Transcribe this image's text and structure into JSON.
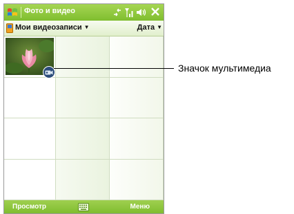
{
  "window": {
    "title": "Фото и видео"
  },
  "toolbar": {
    "folder_label": "Мои видеозаписи",
    "sort_label": "Дата"
  },
  "softkeys": {
    "left": "Просмотр",
    "right": "Меню"
  },
  "callout": {
    "text": "Значок мультимедиа"
  },
  "icons": {
    "start": "windows-flag-icon",
    "connectivity": "connectivity-icon",
    "signal": "signal-icon",
    "volume": "volume-icon",
    "close": "close-icon",
    "keyboard": "keyboard-icon",
    "media": "video-camera-icon"
  },
  "colors": {
    "bar_green": "#8cc63f",
    "grid_line": "#cfdcc0"
  }
}
